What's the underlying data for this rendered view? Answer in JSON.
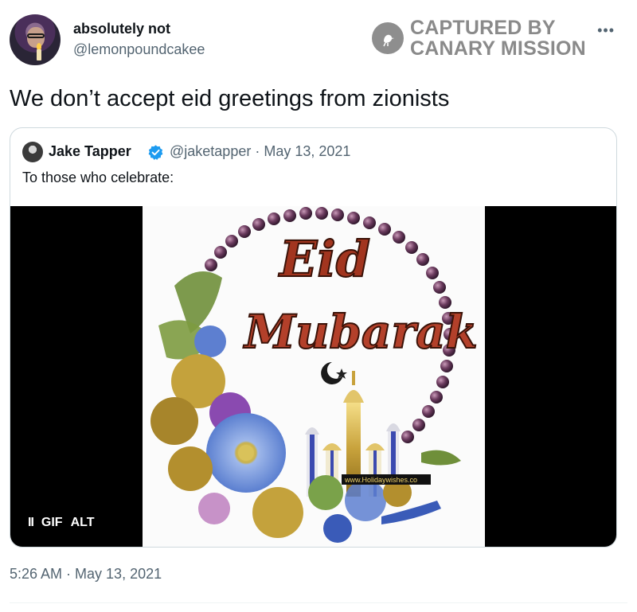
{
  "author": {
    "display_name": "absolutely not",
    "handle": "@lemonpoundcakee"
  },
  "watermark": {
    "line1": "CAPTURED BY",
    "line2": "CANARY MISSION"
  },
  "more_icon": "more-options-icon",
  "tweet": {
    "text": "We don’t accept eid greetings from zionists",
    "timestamp": "5:26 AM · May 13, 2021"
  },
  "quote": {
    "display_name": "Jake Tapper",
    "meta": "@jaketapper · May 13, 2021",
    "text": "To those who celebrate:",
    "verified_color": "#1d9bf0",
    "media": {
      "title_line1": "Eid",
      "title_line2": "Mubarak",
      "site": "www.Holidaywishes.co",
      "controls": {
        "pause": "II",
        "gif": "GIF",
        "alt": "ALT"
      }
    }
  },
  "colors": {
    "text_primary": "#0f1419",
    "text_secondary": "#536471",
    "border": "#cfd9de",
    "watermark": "#8a8a8a"
  }
}
